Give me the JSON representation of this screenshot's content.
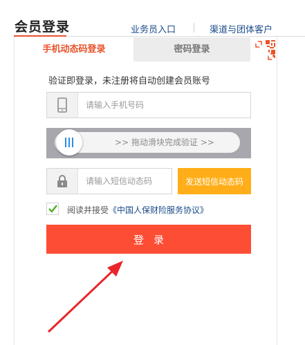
{
  "header": {
    "title": "会员登录",
    "agent_link": "业务员入口",
    "channel_link": "渠道与团体客户"
  },
  "tabs": {
    "sms_label": "手机动态码登录",
    "password_label": "密码登录",
    "active": "sms"
  },
  "form": {
    "info_text": "验证即登录，未注册将自动创建会员账号",
    "phone_placeholder": "请输入手机号码",
    "phone_value": "",
    "slider_text": "拖动滑块完成验证",
    "slider_progress": 0,
    "sms_placeholder": "请输入短信动态码",
    "sms_value": "",
    "send_code_label": "发送短信动态码",
    "agree_prefix": "阅读并接受",
    "agree_link": "《中国人保财险服务协议》",
    "agree_checked": true,
    "login_label": "登录"
  },
  "colors": {
    "accent": "#e8532a",
    "login_button": "#fe4d35",
    "send_button": "#ffae19",
    "link": "#1a4a8a",
    "checkmark": "#4caf20"
  },
  "icons": {
    "phone": "phone-icon",
    "lock": "lock-icon",
    "qr": "qr-code-icon",
    "slider_handle": "slider-grip-icon",
    "check": "checkmark-icon"
  }
}
